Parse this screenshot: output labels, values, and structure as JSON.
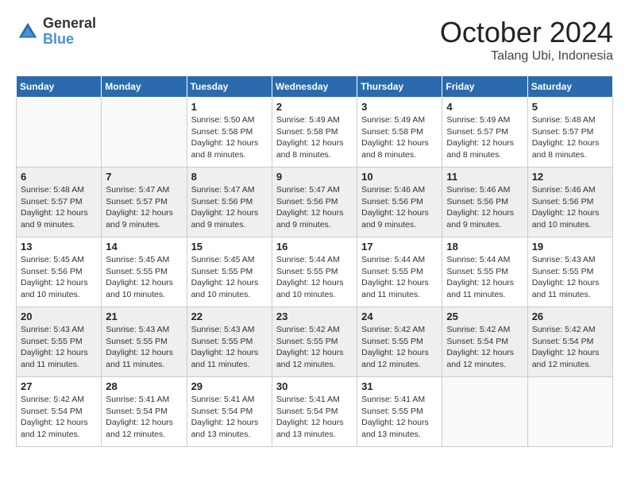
{
  "header": {
    "logo_line1": "General",
    "logo_line2": "Blue",
    "month": "October 2024",
    "location": "Talang Ubi, Indonesia"
  },
  "weekdays": [
    "Sunday",
    "Monday",
    "Tuesday",
    "Wednesday",
    "Thursday",
    "Friday",
    "Saturday"
  ],
  "weeks": [
    [
      {
        "day": "",
        "info": ""
      },
      {
        "day": "",
        "info": ""
      },
      {
        "day": "1",
        "info": "Sunrise: 5:50 AM\nSunset: 5:58 PM\nDaylight: 12 hours and 8 minutes."
      },
      {
        "day": "2",
        "info": "Sunrise: 5:49 AM\nSunset: 5:58 PM\nDaylight: 12 hours and 8 minutes."
      },
      {
        "day": "3",
        "info": "Sunrise: 5:49 AM\nSunset: 5:58 PM\nDaylight: 12 hours and 8 minutes."
      },
      {
        "day": "4",
        "info": "Sunrise: 5:49 AM\nSunset: 5:57 PM\nDaylight: 12 hours and 8 minutes."
      },
      {
        "day": "5",
        "info": "Sunrise: 5:48 AM\nSunset: 5:57 PM\nDaylight: 12 hours and 8 minutes."
      }
    ],
    [
      {
        "day": "6",
        "info": "Sunrise: 5:48 AM\nSunset: 5:57 PM\nDaylight: 12 hours and 9 minutes."
      },
      {
        "day": "7",
        "info": "Sunrise: 5:47 AM\nSunset: 5:57 PM\nDaylight: 12 hours and 9 minutes."
      },
      {
        "day": "8",
        "info": "Sunrise: 5:47 AM\nSunset: 5:56 PM\nDaylight: 12 hours and 9 minutes."
      },
      {
        "day": "9",
        "info": "Sunrise: 5:47 AM\nSunset: 5:56 PM\nDaylight: 12 hours and 9 minutes."
      },
      {
        "day": "10",
        "info": "Sunrise: 5:46 AM\nSunset: 5:56 PM\nDaylight: 12 hours and 9 minutes."
      },
      {
        "day": "11",
        "info": "Sunrise: 5:46 AM\nSunset: 5:56 PM\nDaylight: 12 hours and 9 minutes."
      },
      {
        "day": "12",
        "info": "Sunrise: 5:46 AM\nSunset: 5:56 PM\nDaylight: 12 hours and 10 minutes."
      }
    ],
    [
      {
        "day": "13",
        "info": "Sunrise: 5:45 AM\nSunset: 5:56 PM\nDaylight: 12 hours and 10 minutes."
      },
      {
        "day": "14",
        "info": "Sunrise: 5:45 AM\nSunset: 5:55 PM\nDaylight: 12 hours and 10 minutes."
      },
      {
        "day": "15",
        "info": "Sunrise: 5:45 AM\nSunset: 5:55 PM\nDaylight: 12 hours and 10 minutes."
      },
      {
        "day": "16",
        "info": "Sunrise: 5:44 AM\nSunset: 5:55 PM\nDaylight: 12 hours and 10 minutes."
      },
      {
        "day": "17",
        "info": "Sunrise: 5:44 AM\nSunset: 5:55 PM\nDaylight: 12 hours and 11 minutes."
      },
      {
        "day": "18",
        "info": "Sunrise: 5:44 AM\nSunset: 5:55 PM\nDaylight: 12 hours and 11 minutes."
      },
      {
        "day": "19",
        "info": "Sunrise: 5:43 AM\nSunset: 5:55 PM\nDaylight: 12 hours and 11 minutes."
      }
    ],
    [
      {
        "day": "20",
        "info": "Sunrise: 5:43 AM\nSunset: 5:55 PM\nDaylight: 12 hours and 11 minutes."
      },
      {
        "day": "21",
        "info": "Sunrise: 5:43 AM\nSunset: 5:55 PM\nDaylight: 12 hours and 11 minutes."
      },
      {
        "day": "22",
        "info": "Sunrise: 5:43 AM\nSunset: 5:55 PM\nDaylight: 12 hours and 11 minutes."
      },
      {
        "day": "23",
        "info": "Sunrise: 5:42 AM\nSunset: 5:55 PM\nDaylight: 12 hours and 12 minutes."
      },
      {
        "day": "24",
        "info": "Sunrise: 5:42 AM\nSunset: 5:55 PM\nDaylight: 12 hours and 12 minutes."
      },
      {
        "day": "25",
        "info": "Sunrise: 5:42 AM\nSunset: 5:54 PM\nDaylight: 12 hours and 12 minutes."
      },
      {
        "day": "26",
        "info": "Sunrise: 5:42 AM\nSunset: 5:54 PM\nDaylight: 12 hours and 12 minutes."
      }
    ],
    [
      {
        "day": "27",
        "info": "Sunrise: 5:42 AM\nSunset: 5:54 PM\nDaylight: 12 hours and 12 minutes."
      },
      {
        "day": "28",
        "info": "Sunrise: 5:41 AM\nSunset: 5:54 PM\nDaylight: 12 hours and 12 minutes."
      },
      {
        "day": "29",
        "info": "Sunrise: 5:41 AM\nSunset: 5:54 PM\nDaylight: 12 hours and 13 minutes."
      },
      {
        "day": "30",
        "info": "Sunrise: 5:41 AM\nSunset: 5:54 PM\nDaylight: 12 hours and 13 minutes."
      },
      {
        "day": "31",
        "info": "Sunrise: 5:41 AM\nSunset: 5:55 PM\nDaylight: 12 hours and 13 minutes."
      },
      {
        "day": "",
        "info": ""
      },
      {
        "day": "",
        "info": ""
      }
    ]
  ]
}
